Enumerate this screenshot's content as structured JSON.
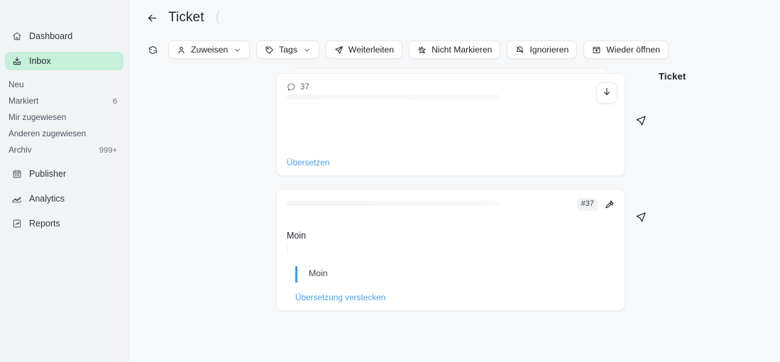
{
  "sidebar": {
    "items": [
      {
        "label": "Dashboard",
        "icon": "home-icon",
        "active": false
      },
      {
        "label": "Inbox",
        "icon": "inbox-icon",
        "active": true
      },
      {
        "label": "Publisher",
        "icon": "calendar-icon",
        "active": false
      },
      {
        "label": "Analytics",
        "icon": "analytics-icon",
        "active": false
      },
      {
        "label": "Reports",
        "icon": "report-icon",
        "active": false
      }
    ],
    "sub_items": [
      {
        "label": "Neu",
        "count": ""
      },
      {
        "label": "Markiert",
        "count": "6"
      },
      {
        "label": "Mir zugewiesen",
        "count": ""
      },
      {
        "label": "Anderen zugewiesen",
        "count": ""
      },
      {
        "label": "Archiv",
        "count": "999+"
      }
    ]
  },
  "header": {
    "back_icon": "arrow-left-icon",
    "title": "Ticket",
    "title_suffix": "("
  },
  "toolbar": {
    "refresh_icon": "refresh-icon",
    "buttons": [
      {
        "label": "Zuweisen",
        "icon": "user-icon",
        "chevron": true
      },
      {
        "label": "Tags",
        "icon": "tag-icon",
        "chevron": true
      },
      {
        "label": "Weiterleiten",
        "icon": "send-icon",
        "chevron": false
      },
      {
        "label": "Nicht Markieren",
        "icon": "star-off-icon",
        "chevron": false
      },
      {
        "label": "Ignorieren",
        "icon": "bell-off-icon",
        "chevron": false
      },
      {
        "label": "Wieder öffnen",
        "icon": "reopen-icon",
        "chevron": false
      }
    ]
  },
  "conversation": {
    "first_card": {
      "message_count": "37",
      "count_icon": "comment-icon",
      "scroll_icon": "arrow-down-icon",
      "translate_link": "Übersetzen"
    },
    "second_card": {
      "badge": "#37",
      "pin_icon": "pin-icon",
      "message": "Moin",
      "quote": "Moin",
      "translate_link": "Übersetzung verstecken"
    }
  },
  "rail": {
    "title": "Ticket"
  },
  "colors": {
    "background": "#f7f8fa",
    "sidebar": "#f2f3f5",
    "active_item": "#c6f0d9",
    "link": "#4aa3e8",
    "quote_border": "#3b9ae1",
    "card": "#ffffff"
  }
}
